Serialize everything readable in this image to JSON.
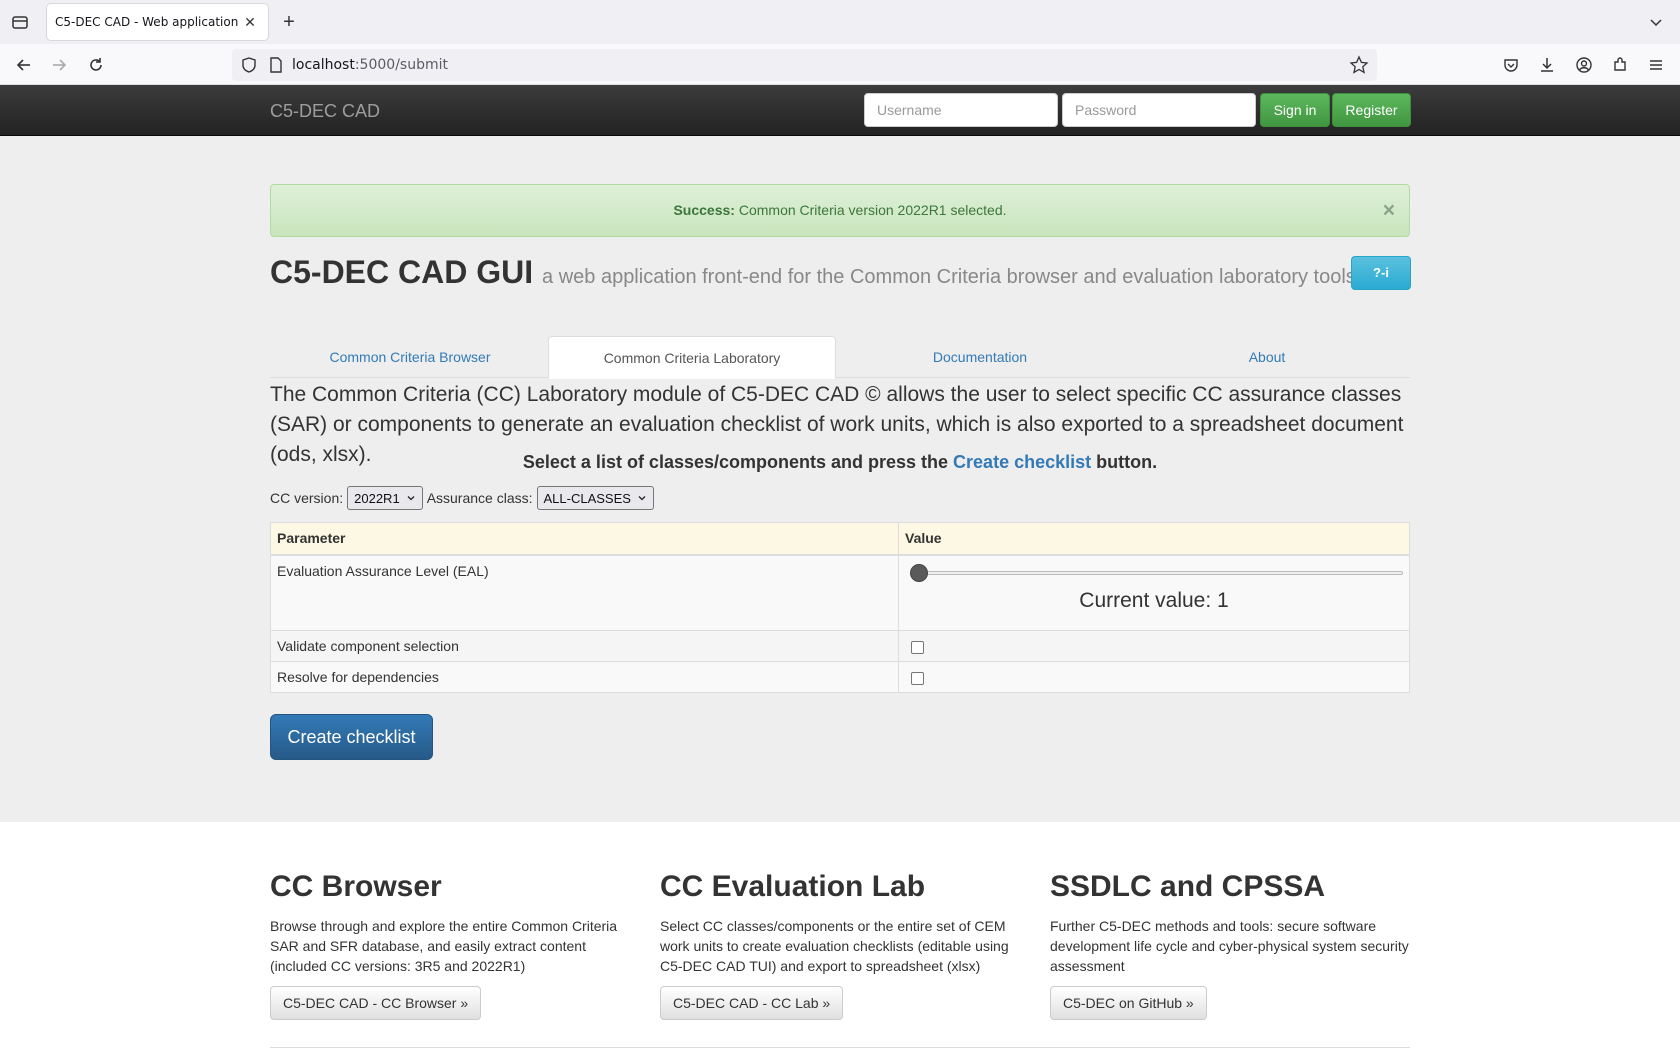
{
  "browser": {
    "tab_title": "C5-DEC CAD - Web application",
    "url_host": "localhost",
    "url_path": ":5000/submit"
  },
  "navbar": {
    "brand": "C5-DEC CAD",
    "username_placeholder": "Username",
    "password_placeholder": "Password",
    "signin_label": "Sign in",
    "register_label": "Register"
  },
  "alert": {
    "strong": "Success:",
    "message": " Common Criteria version 2022R1 selected.",
    "close": "×"
  },
  "header": {
    "title": "C5-DEC CAD GUI",
    "subtitle": "a web application front-end for the Common Criteria browser and evaluation laboratory tools",
    "help_label": "?-i"
  },
  "tabs": [
    {
      "label": "Common Criteria Browser"
    },
    {
      "label": "Common Criteria Laboratory"
    },
    {
      "label": "Documentation"
    },
    {
      "label": "About"
    }
  ],
  "lab": {
    "description": "The Common Criteria (CC) Laboratory module of C5-DEC CAD © allows the user to select specific CC assurance classes (SAR) or components to generate an evaluation checklist of work units, which is also exported to a spreadsheet document (ods, xlsx).",
    "instruction_pre": "Select a list of classes/components and press the ",
    "instruction_link": "Create checklist",
    "instruction_post": " button.",
    "cc_version_label": "CC version:",
    "cc_version_value": "2022R1",
    "assurance_class_label": "Assurance class:",
    "assurance_class_value": "ALL-CLASSES",
    "table": {
      "col_param": "Parameter",
      "col_value": "Value",
      "rows": [
        {
          "param": "Evaluation Assurance Level (EAL)",
          "current_value": "Current value: 1"
        },
        {
          "param": "Validate component selection"
        },
        {
          "param": "Resolve for dependencies"
        }
      ]
    },
    "eal_value": 1,
    "create_button": "Create checklist"
  },
  "features": [
    {
      "title": "CC Browser",
      "text": "Browse through and explore the entire Common Criteria SAR and SFR database, and easily extract content (included CC versions: 3R5 and 2022R1)",
      "button": "C5-DEC CAD - CC Browser »"
    },
    {
      "title": "CC Evaluation Lab",
      "text": "Select CC classes/components or the entire set of CEM work units to create evaluation checklists (editable using C5-DEC CAD TUI) and export to spreadsheet (xlsx)",
      "button": "C5-DEC CAD - CC Lab »"
    },
    {
      "title": "SSDLC and CPSSA",
      "text": "Further C5-DEC methods and tools: secure software development life cycle and cyber-physical system security assessment",
      "button": "C5-DEC on GitHub »"
    }
  ],
  "icons": {
    "tab_list": "tab-list-icon",
    "back": "back-arrow-icon",
    "forward": "forward-arrow-icon",
    "reload": "reload-icon",
    "shield": "shield-icon",
    "bookmark": "star-icon",
    "pocket": "pocket-icon",
    "downloads": "download-icon",
    "account": "account-icon",
    "extensions": "puzzle-icon",
    "menu": "hamburger-menu-icon"
  }
}
